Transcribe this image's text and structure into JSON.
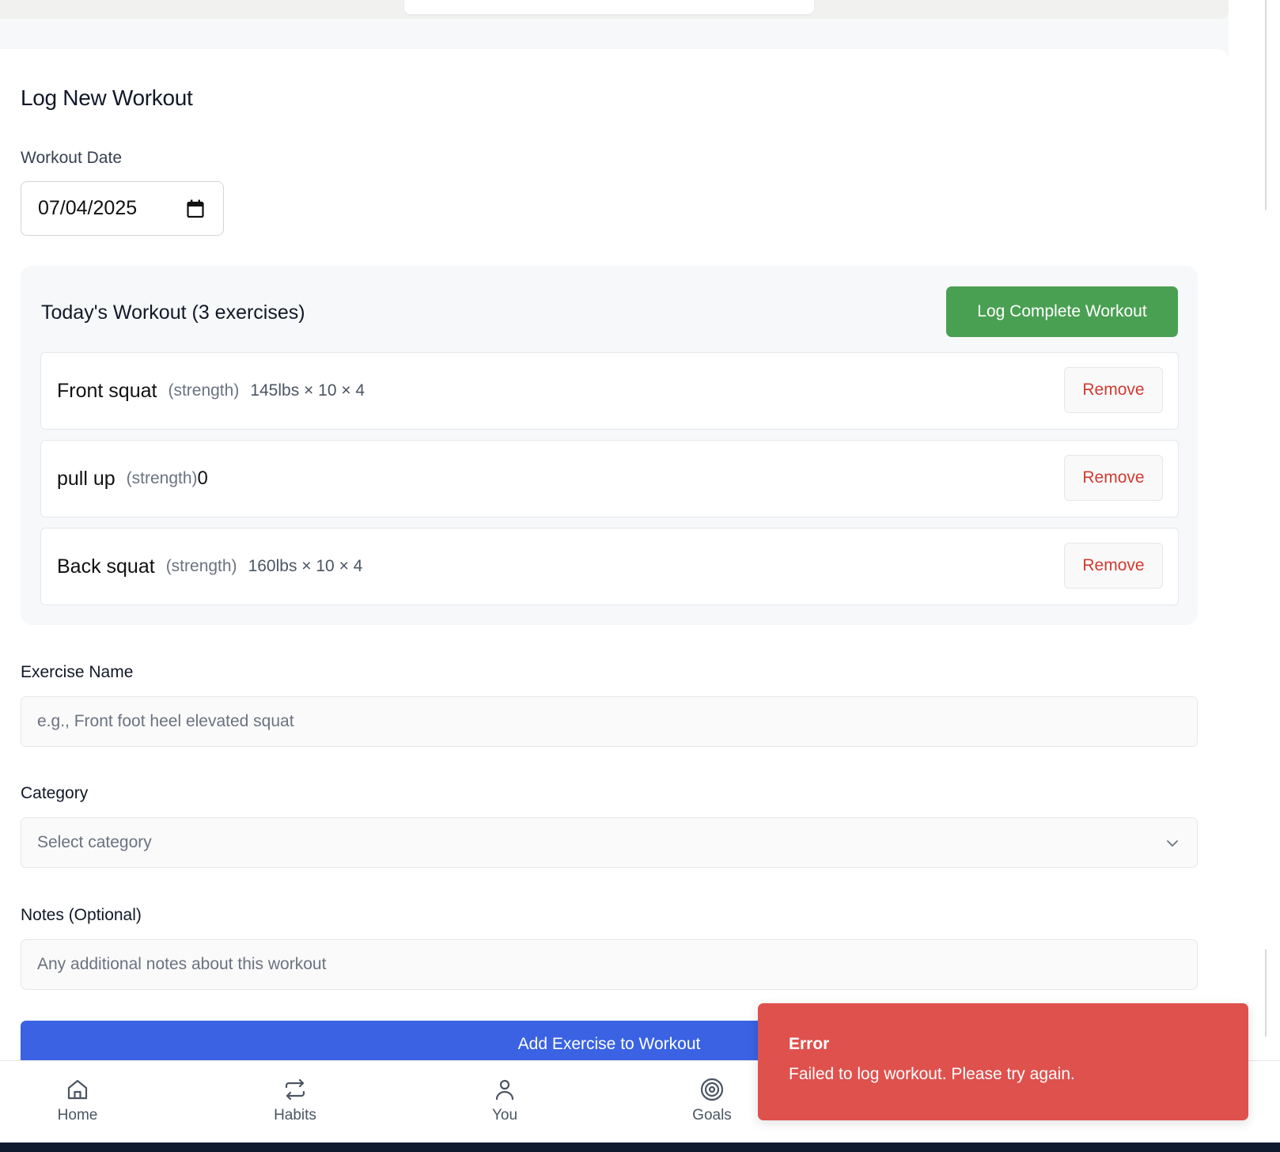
{
  "form": {
    "title": "Log New Workout",
    "date_label": "Workout Date",
    "date_value": "07/04/2025"
  },
  "todays_workout": {
    "title": "Today's Workout (3 exercises)",
    "log_button": "Log Complete Workout",
    "exercises": [
      {
        "name": "Front squat",
        "category": "(strength)",
        "detail": "145lbs × 10 × 4",
        "remove": "Remove"
      },
      {
        "name": "pull up",
        "category": "(strength)",
        "detail": "0",
        "remove": "Remove"
      },
      {
        "name": "Back squat",
        "category": "(strength)",
        "detail": "160lbs × 10 × 4",
        "remove": "Remove"
      }
    ]
  },
  "exercise_name": {
    "label": "Exercise Name",
    "placeholder": "e.g., Front foot heel elevated squat"
  },
  "category": {
    "label": "Category",
    "placeholder": "Select category"
  },
  "notes": {
    "label": "Notes (Optional)",
    "placeholder": "Any additional notes about this workout"
  },
  "add_button": "Add Exercise to Workout",
  "nav": {
    "items": [
      {
        "label": "Home",
        "icon": "home-icon"
      },
      {
        "label": "Habits",
        "icon": "repeat-icon"
      },
      {
        "label": "You",
        "icon": "user-icon"
      },
      {
        "label": "Goals",
        "icon": "target-icon"
      }
    ]
  },
  "toast": {
    "title": "Error",
    "message": "Failed to log workout. Please try again."
  },
  "colors": {
    "log_button": "#4aa052",
    "remove_text": "#d13b30",
    "add_button": "#3a62e3",
    "toast_bg": "#df514d"
  }
}
